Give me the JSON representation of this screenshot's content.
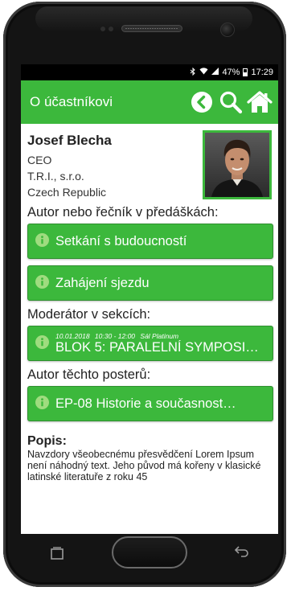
{
  "statusbar": {
    "bluetooth_icon": "bluetooth-icon",
    "wifi_icon": "wifi-icon",
    "signal_icon": "signal-icon",
    "battery": "47%",
    "battery_level": 0.47,
    "time": "17:29"
  },
  "appbar": {
    "title": "O účastníkovi",
    "back_icon": "back-circle-icon",
    "search_icon": "search-icon",
    "home_icon": "home-icon",
    "color": "#3cb83c"
  },
  "person": {
    "name": "Josef Blecha",
    "position": "CEO",
    "company": "T.R.I., s.r.o.",
    "country": "Czech Republic"
  },
  "sections": {
    "author_title": "Autor nebo řečník v předáškách:",
    "author_items": [
      "Setkání s budoucností",
      "Zahájení sjezdu"
    ],
    "moderator_title": "Moderátor v sekcích:",
    "moderator_item": {
      "date": "10.01.2018",
      "time": "10:30 - 12:00",
      "room": "Sál Platinum",
      "label": "BLOK 5: PARALELNÍ SYMPOSI…"
    },
    "posters_title": "Autor těchto posterů:",
    "poster_item": "EP-08 Historie a současnost…"
  },
  "popis": {
    "title": "Popis:",
    "text": "Navzdory všeobecnému přesvědčení Lorem Ipsum není náhodný text. Jeho původ má kořeny v klasické latinské literatuře z roku 45"
  }
}
